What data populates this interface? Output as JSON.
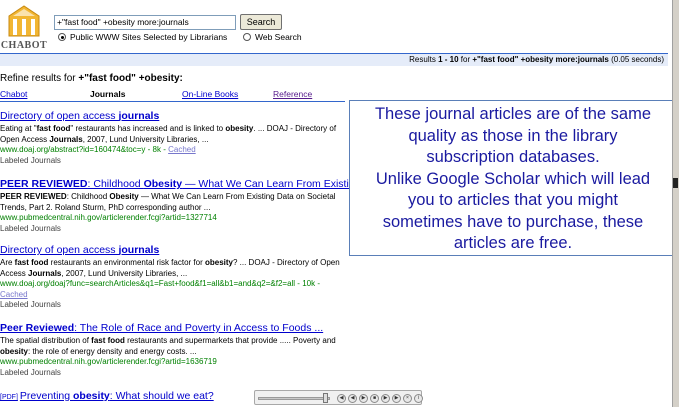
{
  "logo": {
    "text": "CHABOT"
  },
  "search": {
    "query": "+\"fast food\" +obesity more:journals",
    "button_label": "Search",
    "options": [
      {
        "label": "Public WWW Sites Selected by Librarians",
        "selected": true
      },
      {
        "label": "Web Search",
        "selected": false
      }
    ]
  },
  "results_summary": {
    "prefix": "Results",
    "range": "1 - 10",
    "for_label": "for",
    "query": "+\"fast food\" +obesity more:journals",
    "time": "(0.05 seconds)"
  },
  "refine": {
    "label": "Refine results for",
    "query": "+\"fast food\" +obesity:",
    "tabs": [
      {
        "label": "Chabot",
        "state": "link"
      },
      {
        "label": "Journals",
        "state": "active"
      },
      {
        "label": "On-Line Books",
        "state": "link"
      },
      {
        "label": "Reference",
        "state": "visited"
      }
    ]
  },
  "results": [
    {
      "title_pre": "Directory of open access ",
      "title_bold": "journals",
      "snippet": "Eating at \"fast food\" restaurants has increased and is linked to obesity. ... DOAJ - Directory of Open Access Journals, 2007, Lund University Libraries, ...",
      "url": "www.doaj.org/abstract?id=160474&toc=y - 8k -",
      "cached": "Cached",
      "label": "Labeled Journals"
    },
    {
      "title_peer": "PEER REVIEWED",
      "title_pre": ": Childhood ",
      "title_bold": "Obesity",
      "title_post": " — What We Can Learn From Existing Data",
      "snippet": "PEER REVIEWED: Childhood Obesity — What We Can Learn From Existing Data on Societal Trends, Part 2. Roland Sturm, PhD corresponding author ...",
      "url": "www.pubmedcentral.nih.gov/articlerender.fcgi?artid=1327714",
      "label": "Labeled Journals"
    },
    {
      "title_pre": "Directory of open access ",
      "title_bold": "journals",
      "snippet": "Are fast food restaurants an environmental risk factor for obesity? ... DOAJ - Directory of Open Access Journals, 2007, Lund University Libraries, ...",
      "url": "www.doaj.org/doaj?func=searchArticles&q1=Fast+food&f1=all&b1=and&q2=&f2=all - 10k -",
      "cached": "Cached",
      "label": "Labeled Journals"
    },
    {
      "title_peer": "Peer Reviewed",
      "title_pre": ": The Role of Race and Poverty in Access to Foods ...",
      "snippet": "The spatial distribution of fast food restaurants and supermarkets that provide ..... Poverty and obesity: the role of energy density and energy costs. ...",
      "url": "www.pubmedcentral.nih.gov/articlerender.fcgi?artid=1636719",
      "label": "Labeled Journals"
    },
    {
      "tag": "[PDF]",
      "title_pre": "Preventing ",
      "title_bold": "obesity",
      "title_post": ": What should we eat?"
    }
  ],
  "callout": {
    "lines": [
      "These journal articles are of the same",
      "quality as those in the library",
      "subscription databases.",
      "Unlike Google Scholar which will lead",
      "you to articles that you might",
      "sometimes have to purchase, these",
      "articles are free."
    ]
  },
  "media_controls": [
    "rewind",
    "previous",
    "play",
    "stop",
    "next",
    "fast-forward",
    "close",
    "info"
  ]
}
